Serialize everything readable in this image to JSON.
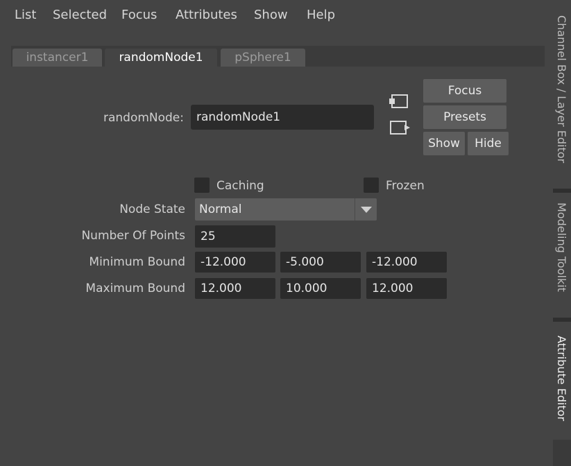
{
  "menu": [
    "List",
    "Selected",
    "Focus",
    "Attributes",
    "Show",
    "Help"
  ],
  "tabs": [
    {
      "label": "instancer1",
      "active": false
    },
    {
      "label": "randomNode1",
      "active": true
    },
    {
      "label": "pSphere1",
      "active": false
    }
  ],
  "node": {
    "type_label": "randomNode:",
    "name_value": "randomNode1"
  },
  "buttons": {
    "focus": "Focus",
    "presets": "Presets",
    "show": "Show",
    "hide": "Hide"
  },
  "attributes": {
    "caching_label": "Caching",
    "caching_checked": false,
    "frozen_label": "Frozen",
    "frozen_checked": false,
    "node_state_label": "Node State",
    "node_state_value": "Normal",
    "number_of_points_label": "Number Of Points",
    "number_of_points_value": "25",
    "minimum_bound_label": "Minimum Bound",
    "minimum_bound": [
      "-12.000",
      "-5.000",
      "-12.000"
    ],
    "maximum_bound_label": "Maximum Bound",
    "maximum_bound": [
      "12.000",
      "10.000",
      "12.000"
    ]
  },
  "side_panels": [
    {
      "label": "Channel Box / Layer Editor",
      "active": false
    },
    {
      "label": "Modeling Toolkit",
      "active": false
    },
    {
      "label": "Attribute Editor",
      "active": true
    }
  ],
  "icons": {
    "load_input": "load-input-icon",
    "load_output": "load-output-icon",
    "dropdown": "chevron-down-icon"
  }
}
